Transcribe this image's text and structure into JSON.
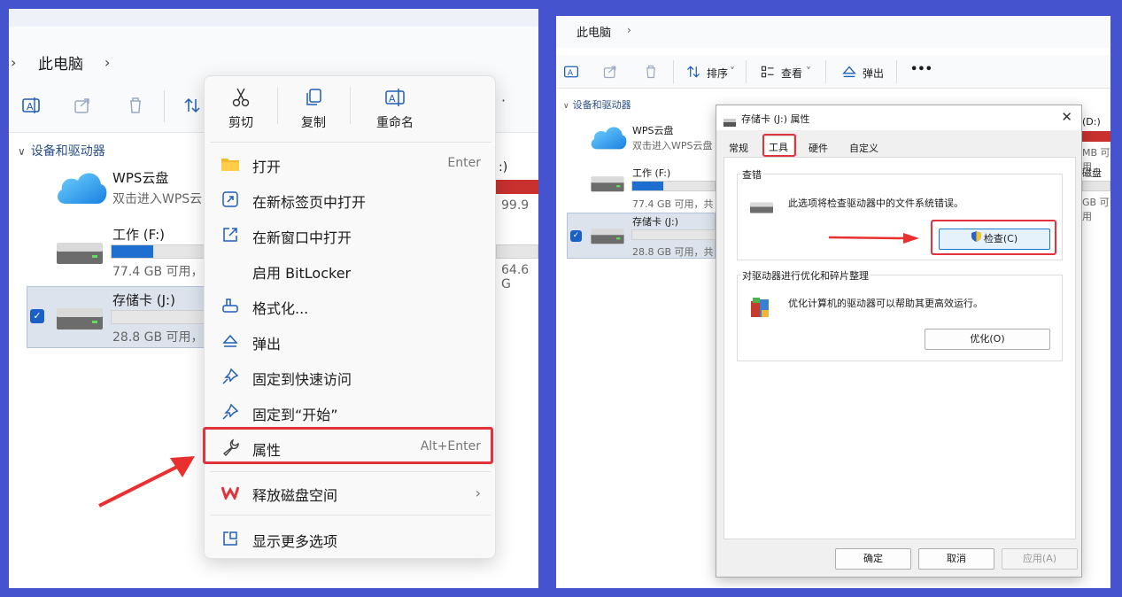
{
  "left": {
    "breadcrumb": "此电脑",
    "group_label": "设备和驱动器",
    "drives": [
      {
        "name": "WPS云盘",
        "sub": "双击进入WPS云"
      },
      {
        "name": "工作 (F:)",
        "sub": "77.4 GB 可用，",
        "usage": 0.22
      },
      {
        "name": "存储卡 (J:)",
        "sub": "28.8 GB 可用，",
        "usage": 0.0
      }
    ],
    "partial_right": {
      "a": ":)",
      "b": "99.9 ",
      "c": "64.6 G"
    },
    "context_menu": {
      "quick_actions": [
        "剪切",
        "复制",
        "重命名"
      ],
      "items": [
        {
          "label": "打开",
          "shortcut": "Enter"
        },
        {
          "label": "在新标签页中打开",
          "shortcut": ""
        },
        {
          "label": "在新窗口中打开",
          "shortcut": ""
        },
        {
          "label": "启用 BitLocker",
          "shortcut": ""
        },
        {
          "label": "格式化...",
          "shortcut": ""
        },
        {
          "label": "弹出",
          "shortcut": ""
        },
        {
          "label": "固定到快速访问",
          "shortcut": ""
        },
        {
          "label": "固定到“开始”",
          "shortcut": ""
        },
        {
          "label": "属性",
          "shortcut": "Alt+Enter"
        }
      ],
      "free_space": "释放磁盘空间",
      "more_options": "显示更多选项"
    }
  },
  "right": {
    "breadcrumb": "此电脑",
    "toolbar": {
      "sort": "排序",
      "view": "查看",
      "eject": "弹出",
      "more": "•••"
    },
    "group_label": "设备和驱动器",
    "drives": [
      {
        "name": "WPS云盘",
        "sub": "双击进入WPS云盘"
      },
      {
        "name": "工作 (F:)",
        "sub": "77.4 GB 可用，共",
        "usage": 0.32
      },
      {
        "name": "存储卡 (J:)",
        "sub": "28.8 GB 可用，共",
        "usage": 0.0
      }
    ],
    "partial_right": {
      "a": "(D:)",
      "b": "MB 可用",
      "c": "磁盘 (H",
      "d": "GB 可用"
    },
    "dialog": {
      "title": "存储卡 (J:) 属性",
      "close": "✕",
      "tabs": [
        "常规",
        "工具",
        "硬件",
        "自定义"
      ],
      "check_group": "查错",
      "check_text": "此选项将检查驱动器中的文件系统错误。",
      "check_button": "检查(C)",
      "opt_group": "对驱动器进行优化和碎片整理",
      "opt_text": "优化计算机的驱动器可以帮助其更高效运行。",
      "opt_button": "优化(O)",
      "ok": "确定",
      "cancel": "取消",
      "apply": "应用(A)"
    }
  },
  "colors": {
    "frame": "#4553cf",
    "highlight": "#e2333d",
    "arrow": "#e9302f",
    "accent": "#1f6fd0"
  }
}
